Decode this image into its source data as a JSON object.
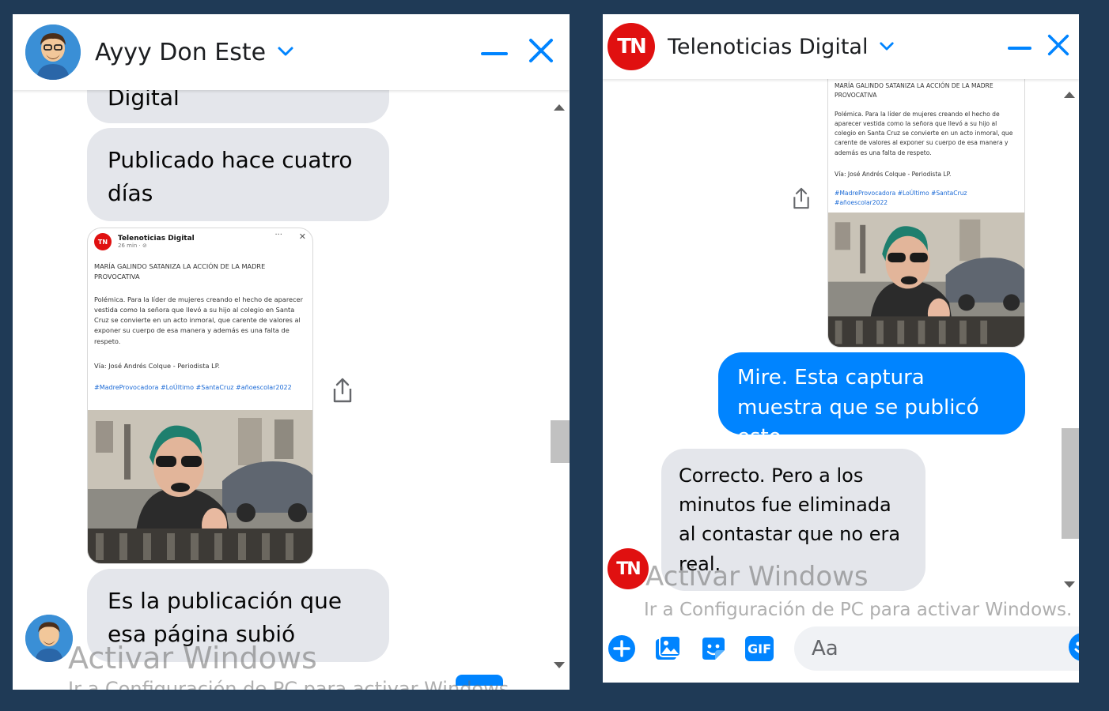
{
  "left": {
    "contact_name": "Ayyy Don Este",
    "messages": {
      "cut_top": "Digital",
      "published": "Publicado hace cuatro días",
      "publication": "Es la publicación que esa página subió"
    },
    "watermark": {
      "line1": "Activar Windows",
      "line2": "Ir a Configuración de PC para activar Windows."
    }
  },
  "right": {
    "contact_name": "Telenoticias Digital",
    "avatar_text": "TN",
    "messages": {
      "outgoing": "Mire. Esta captura muestra que se publicó esto.",
      "incoming": "Correcto. Pero a los minutos fue eliminada al contastar que no era real."
    },
    "composer": {
      "placeholder": "Aa",
      "gif_label": "GIF"
    },
    "watermark": {
      "line1": "Activar Windows",
      "line2": "Ir a Configuración de PC para activar Windows."
    }
  },
  "post": {
    "page_name": "Telenoticias Digital",
    "time": "26 min · ⊘",
    "avatar_text": "TN",
    "headline": "MARÍA GALINDO SATANIZA LA ACCIÓN DE LA MADRE PROVOCATIVA",
    "body": "Polémica. Para la líder de mujeres creando el hecho de aparecer vestida como la señora que llevó a su hijo al colegio en Santa Cruz se convierte en un acto inmoral, que carente de valores al exponer su cuerpo de esa manera y además es una falta de respeto.",
    "via": "Vía: José Andrés Colque - Periodista LP.",
    "tags": "#MadreProvocadora #LoÚltimo #SantaCruz #añoescolar2022",
    "more": "···",
    "close": "✕"
  },
  "colors": {
    "background": "#1f3a56",
    "messenger_blue": "#0084ff",
    "bubble_gray": "#e4e6eb",
    "tn_red": "#e01010"
  }
}
